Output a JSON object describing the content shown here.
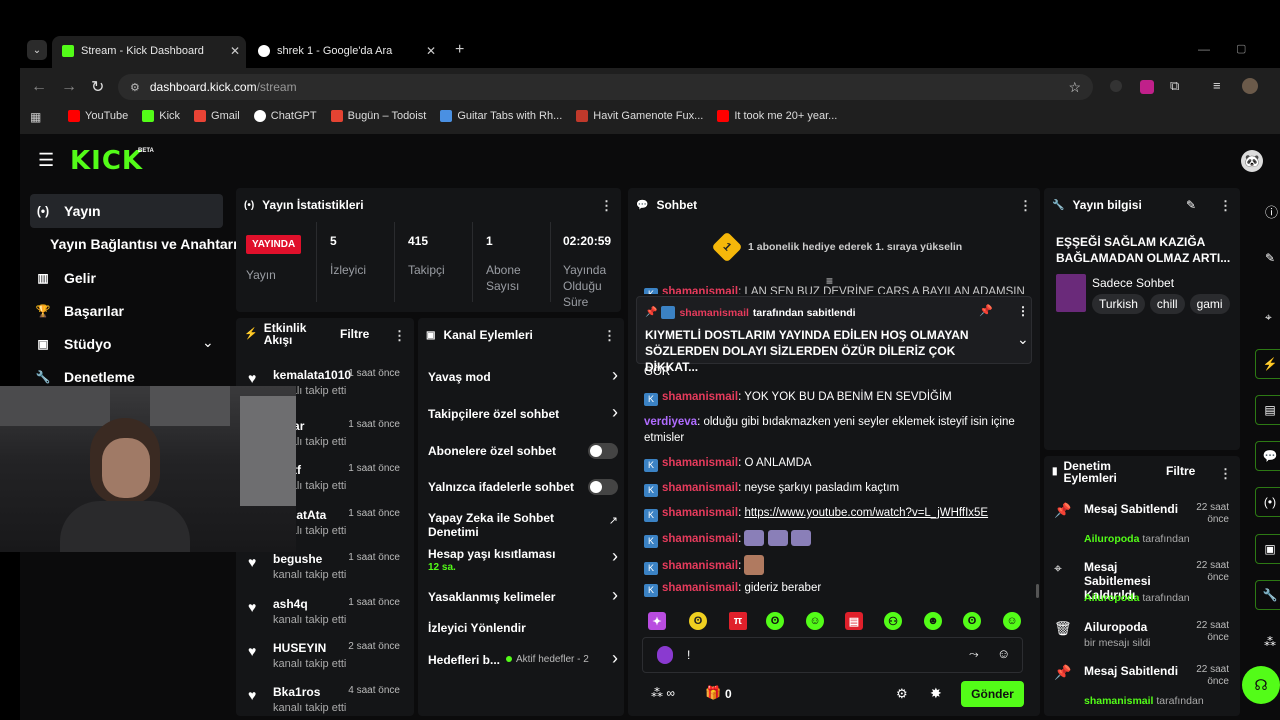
{
  "browser": {
    "tabs": [
      {
        "title": "Stream - Kick Dashboard",
        "active": true
      },
      {
        "title": "shrek 1 - Google'da Ara",
        "active": false
      }
    ],
    "url_host": "dashboard.kick.com",
    "url_path": "/stream",
    "bookmarks": [
      {
        "label": "YouTube",
        "color": "#ff0000"
      },
      {
        "label": "Kick",
        "color": "#53fc18"
      },
      {
        "label": "Gmail",
        "color": "#ea4335"
      },
      {
        "label": "ChatGPT",
        "color": "#ffffff"
      },
      {
        "label": "Bugün – Todoist",
        "color": "#e44332"
      },
      {
        "label": "Guitar Tabs with Rh...",
        "color": "#4a90e2"
      },
      {
        "label": "Havit Gamenote Fux...",
        "color": "#c0392b"
      },
      {
        "label": "It took me 20+ year...",
        "color": "#ff0000"
      }
    ]
  },
  "header": {
    "logo": "KICK",
    "beta": "BETA"
  },
  "sidebar": {
    "items": [
      {
        "label": "Yayın",
        "icon": "broadcast-icon"
      },
      {
        "label": "Yayın Bağlantısı ve Anahtarı",
        "icon": ""
      },
      {
        "label": "Gelir",
        "icon": "chart-icon"
      },
      {
        "label": "Başarılar",
        "icon": "trophy-icon"
      },
      {
        "label": "Stüdyo",
        "icon": "studio-icon"
      },
      {
        "label": "Denetleme",
        "icon": "wrench-icon"
      }
    ]
  },
  "stats": {
    "title": "Yayın İstatistikleri",
    "live_badge": "YAYINDA",
    "live_label": "Yayın",
    "columns": [
      {
        "value": "5",
        "label": "İzleyici"
      },
      {
        "value": "415",
        "label": "Takipçi"
      },
      {
        "value": "1",
        "label": "Abone Sayısı"
      },
      {
        "value": "02:20:59",
        "label": "Yayında Olduğu Süre"
      }
    ]
  },
  "events": {
    "title": "Etkinlik Akışı",
    "filter": "Filtre",
    "items": [
      {
        "name": "kemalata1010",
        "sub": "kanalı takip etti",
        "time": "1 saat önce"
      },
      {
        "name": "yakar",
        "sub": "kanalı takip etti",
        "time": "1 saat önce"
      },
      {
        "name": "ujwtf",
        "sub": "kanalı takip etti",
        "time": "1 saat önce"
      },
      {
        "name": "KopatAta",
        "sub": "kanalı takip etti",
        "time": "1 saat önce"
      },
      {
        "name": "begushe",
        "sub": "kanalı takip etti",
        "time": "1 saat önce"
      },
      {
        "name": "ash4q",
        "sub": "kanalı takip etti",
        "time": "1 saat önce"
      },
      {
        "name": "HUSEYIN",
        "sub": "kanalı takip etti",
        "time": "2 saat önce"
      },
      {
        "name": "Bka1ros",
        "sub": "kanalı takip etti",
        "time": "4 saat önce"
      }
    ]
  },
  "channel_actions": {
    "title": "Kanal Eylemleri",
    "items": [
      {
        "label": "Yavaş mod",
        "kind": "arrow"
      },
      {
        "label": "Takipçilere özel sohbet",
        "kind": "arrow"
      },
      {
        "label": "Abonelere özel sohbet",
        "kind": "toggle"
      },
      {
        "label": "Yalnızca ifadelerle sohbet",
        "kind": "toggle"
      },
      {
        "label": "Yapay Zeka ile Sohbet Denetimi",
        "kind": "external"
      },
      {
        "label": "Hesap yaşı kısıtlaması",
        "kind": "arrow",
        "sub": "12 sa."
      },
      {
        "label": "Yasaklanmış kelimeler",
        "kind": "arrow"
      },
      {
        "label": "İzleyici Yönlendir",
        "kind": "none"
      },
      {
        "label": "Hedefleri b...",
        "kind": "arrow",
        "extra": "Aktif hedefler - 2"
      }
    ]
  },
  "chat": {
    "title": "Sohbet",
    "sub_banner": "1 abonelik hediye ederek 1. sıraya yükselin",
    "rank": "1",
    "cutoff_line": "LAN SEN BUZ DEVRİNE ÇARS A BAYILAN ADAMSIN",
    "pinned_by_user": "shamanismail",
    "pinned_by_suffix": "tarafından sabitlendi",
    "pinned_text": "KIYMETLİ DOSTLARIM YAYINDA EDİLEN HOŞ OLMAYAN SÖZLERDEN DOLAYI SİZLERDEN ÖZÜR DİLERİZ ÇOK DİKKAT...",
    "gor": "GÖR",
    "messages": [
      {
        "user": "shamanismail",
        "text": "YOK YOK BU DA BENİM EN SEVDİĞİM"
      },
      {
        "user": "verdiyeva",
        "text": "olduğu gibi bıdakmazken yeni seyler eklemek isteyif isin içine etmisler"
      },
      {
        "user": "shamanismail",
        "text": "O ANLAMDA"
      },
      {
        "user": "shamanismail",
        "text": "neyse şarkıyı pasladım kaçtım"
      },
      {
        "user": "shamanismail",
        "text": "https://www.youtube.com/watch?v=L_jWHffIx5E"
      },
      {
        "user": "shamanismail",
        "text": ""
      },
      {
        "user": "shamanismail",
        "text": ""
      },
      {
        "user": "shamanismail",
        "text": "gideriz beraber"
      }
    ],
    "input_value": "!",
    "points": "0",
    "send": "Gönder"
  },
  "stream_info": {
    "title": "Yayın bilgisi",
    "stream_title": "EŞŞEĞİ SAĞLAM KAZIĞA BAĞLAMADAN OLMAZ ARTI...",
    "category": "Sadece Sohbet",
    "tags": [
      "Turkish",
      "chill",
      "gami"
    ]
  },
  "mod_actions": {
    "title": "Denetim Eylemleri",
    "filter": "Filtre",
    "items": [
      {
        "icon": "pin-icon",
        "title": "Mesaj Sabitlendi",
        "user": "Ailuropoda",
        "suffix": "tarafından",
        "time": "22 saat önce"
      },
      {
        "icon": "unpin-icon",
        "title": "Mesaj Sabitlemesi Kaldırıldı",
        "user": "Ailuropoda",
        "suffix": "tarafından",
        "time": "22 saat önce"
      },
      {
        "icon": "trash-icon",
        "title": "Ailuropoda",
        "user": "",
        "suffix": "bir mesajı sildi",
        "time": "22 saat önce"
      },
      {
        "icon": "pin-icon",
        "title": "Mesaj Sabitlendi",
        "user": "shamanismail",
        "suffix": "tarafından",
        "time": "22 saat önce"
      }
    ]
  },
  "colors": {
    "accent": "#53fc18",
    "panel": "#141517",
    "live": "#e0102b"
  }
}
